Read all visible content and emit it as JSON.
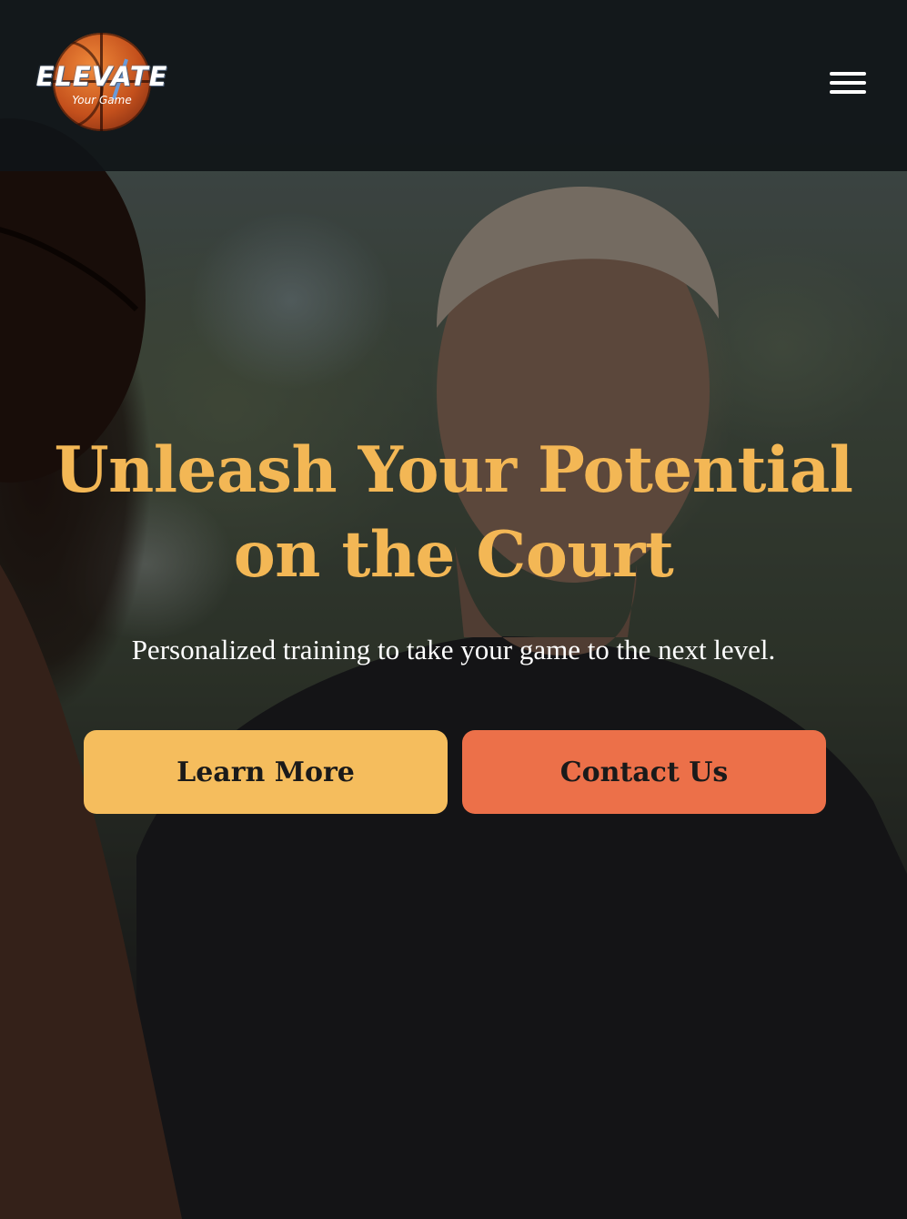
{
  "brand": {
    "logo_wordmark": "ELEVATE",
    "logo_tagline": "Your Game"
  },
  "header": {
    "menu_icon": "hamburger-menu-icon"
  },
  "hero": {
    "title": "Unleash Your Potential on the Court",
    "subtitle": "Personalized training to take your game to the next level.",
    "buttons": {
      "learn_more": "Learn More",
      "contact_us": "Contact Us"
    }
  },
  "colors": {
    "header_bg": "#10141a",
    "title": "#f3b755",
    "learn_more_button": "#f5bd5d",
    "contact_us_button": "#ec7049",
    "button_text": "#1a1a1a",
    "subtitle": "#ffffff"
  }
}
